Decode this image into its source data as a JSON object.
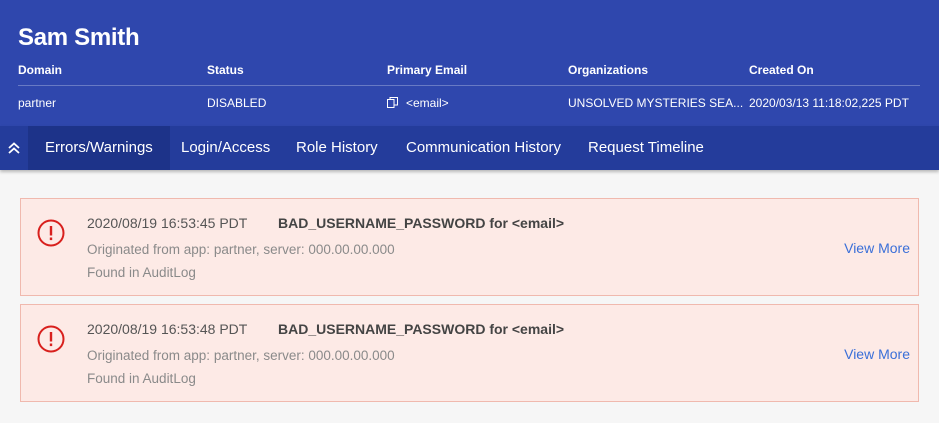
{
  "user": {
    "name": "Sam Smith"
  },
  "summary": {
    "columns": [
      {
        "label": "Domain",
        "value": "partner"
      },
      {
        "label": "Status",
        "value": "DISABLED"
      },
      {
        "label": "Primary Email",
        "value": "<email>",
        "icon": "copy-icon"
      },
      {
        "label": "Organizations",
        "value": "UNSOLVED MYSTERIES SEA..."
      },
      {
        "label": "Created On",
        "value": "2020/03/13 11:18:02,225 PDT"
      }
    ]
  },
  "tabs": [
    {
      "label": "Errors/Warnings",
      "active": true
    },
    {
      "label": "Login/Access",
      "active": false
    },
    {
      "label": "Role History",
      "active": false
    },
    {
      "label": "Communication History",
      "active": false
    },
    {
      "label": "Request Timeline",
      "active": false
    }
  ],
  "events": [
    {
      "timestamp": "2020/08/19 16:53:45 PDT",
      "title": "BAD_USERNAME_PASSWORD for <email>",
      "origin": "Originated from app: partner, server: 000.00.00.000",
      "found": "Found in AuditLog",
      "action": "View More"
    },
    {
      "timestamp": "2020/08/19 16:53:48 PDT",
      "title": "BAD_USERNAME_PASSWORD for <email>",
      "origin": "Originated from app: partner, server: 000.00.00.000",
      "found": "Found in AuditLog",
      "action": "View More"
    }
  ],
  "colors": {
    "header_bg": "#2f47ad",
    "tabbar_bg": "#243c9b",
    "tab_active_bg": "#1d3389",
    "card_bg": "#fdeae6",
    "card_border": "#f0b9ae",
    "alert_red": "#d8201d",
    "link_blue": "#3a6fd8"
  }
}
